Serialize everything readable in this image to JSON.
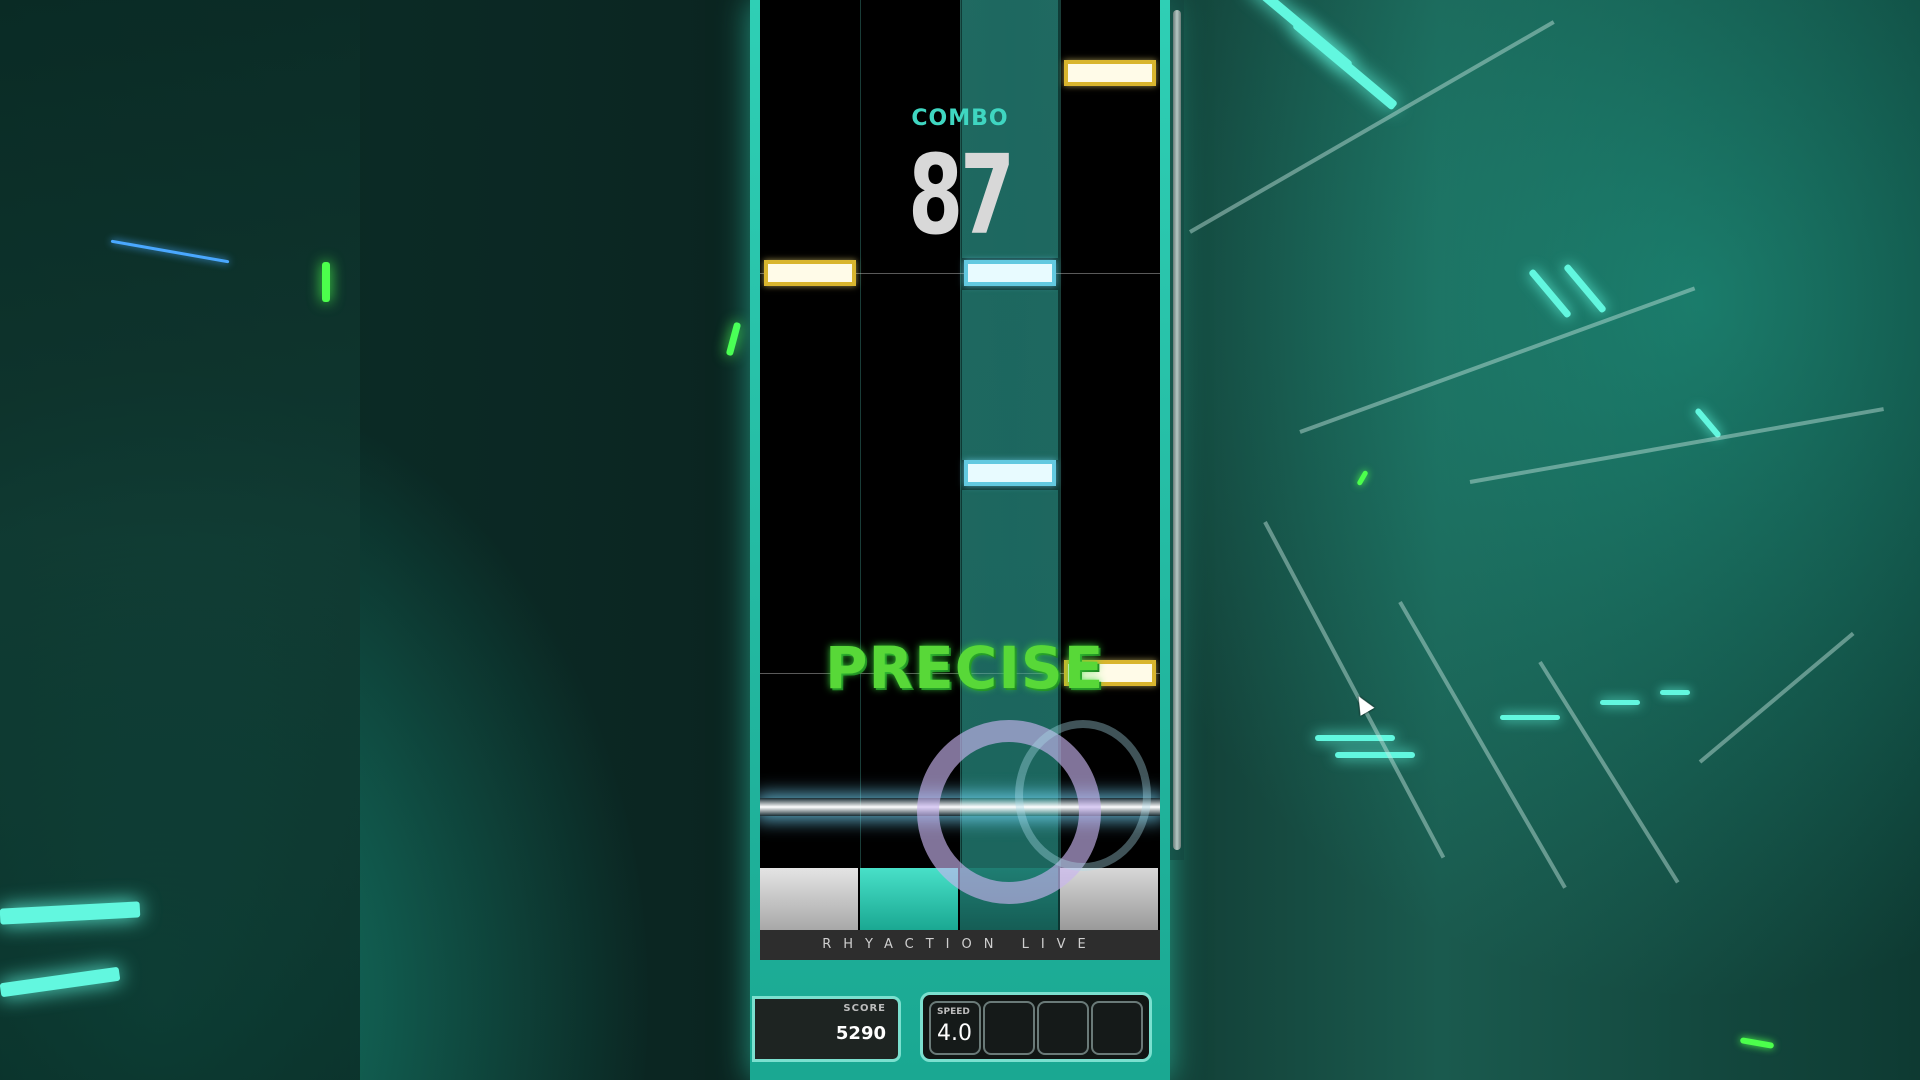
{
  "hud": {
    "combo_label": "COMBO",
    "combo_value": "87",
    "judgment": "PRECISE",
    "brand": "RHYACTION LIVE",
    "score_label": "SCORE",
    "score_value": "5290",
    "speed_label": "SPEED",
    "speed_value": "4.0"
  },
  "colors": {
    "accent": "#3fd6c1",
    "judgment_precise": "#58d838",
    "note_tap": "#fffbe8",
    "note_hold": "#e8fbff"
  },
  "icons": {
    "cursor": "mouse-pointer-icon"
  }
}
